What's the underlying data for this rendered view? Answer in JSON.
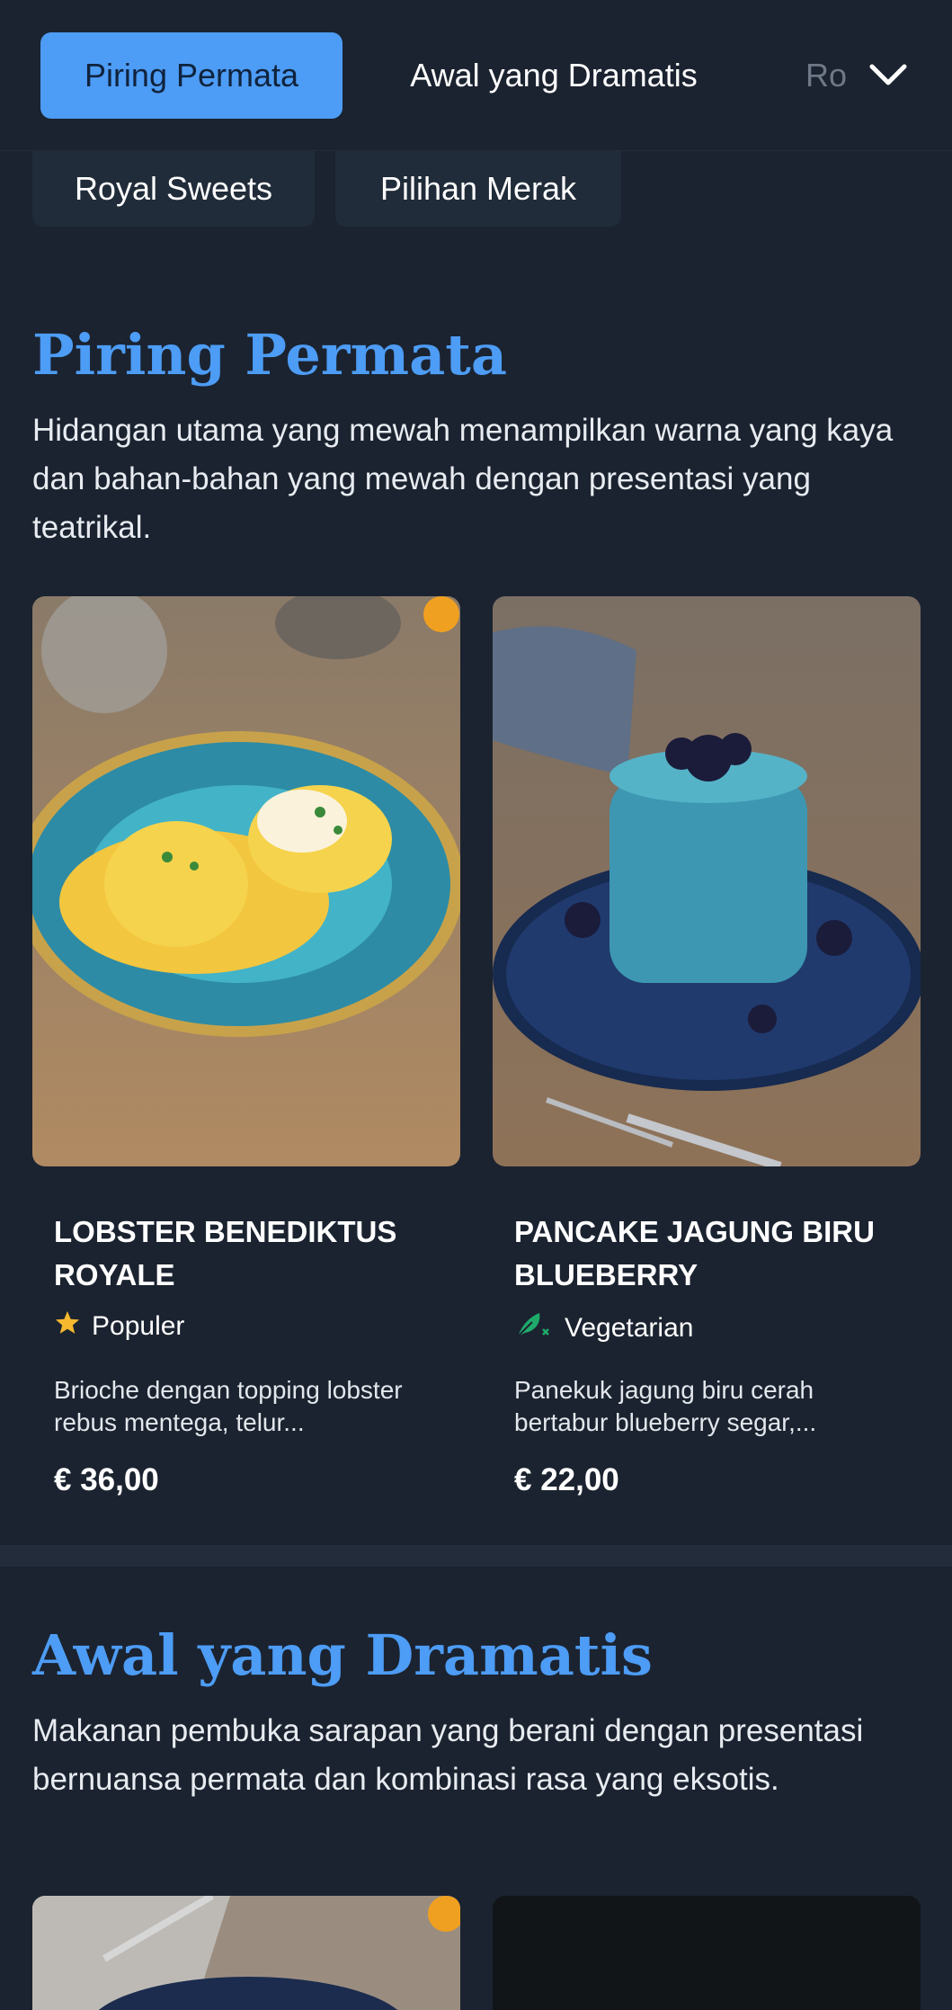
{
  "nav": {
    "tabs": [
      {
        "label": "Piring Permata",
        "active": true
      },
      {
        "label": "Awal yang Dramatis",
        "active": false
      },
      {
        "label": "Ro",
        "active": false
      }
    ],
    "subtabs": [
      {
        "label": "Royal Sweets"
      },
      {
        "label": "Pilihan Merak"
      }
    ],
    "expand_icon": "chevron-down-icon"
  },
  "sections": [
    {
      "title": "Piring Permata",
      "description": "Hidangan utama yang mewah menampilkan warna yang kaya dan bahan-bahan yang mewah dengan presentasi yang teatrikal.",
      "items": [
        {
          "name": "LOBSTER BENEDIKTUS ROYALE",
          "tag": "Populer",
          "tag_icon": "star-icon",
          "description": "Brioche dengan topping lobster rebus mentega, telur...",
          "price": "€ 36,00"
        },
        {
          "name": "PANCAKE JAGUNG BIRU BLUEBERRY",
          "tag": "Vegetarian",
          "tag_icon": "leaf-icon",
          "description": "Panekuk jagung biru cerah bertabur blueberry segar,...",
          "price": "€ 22,00"
        }
      ]
    },
    {
      "title": "Awal yang Dramatis",
      "description": "Makanan pembuka sarapan yang berani dengan presentasi bernuansa permata dan kombinasi rasa yang eksotis."
    }
  ],
  "colors": {
    "background": "#1b2330",
    "accent": "#4d9cf5",
    "star": "#f5b82e",
    "leaf": "#1faa6b"
  }
}
